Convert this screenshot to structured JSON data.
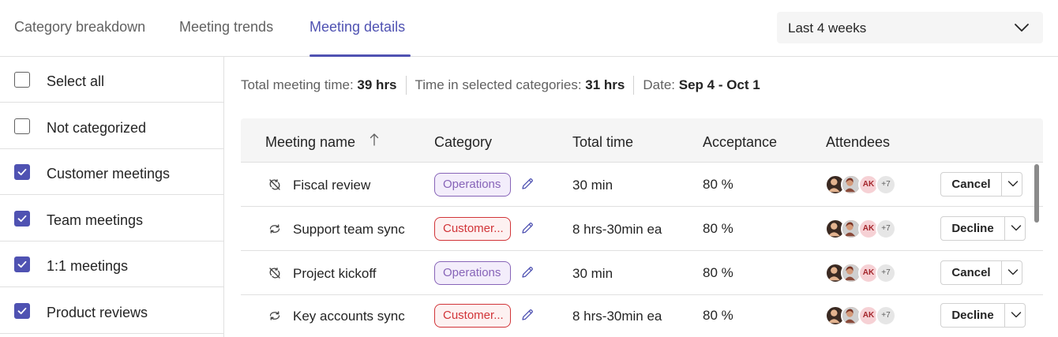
{
  "tabs": [
    {
      "label": "Category breakdown",
      "active": false
    },
    {
      "label": "Meeting trends",
      "active": false
    },
    {
      "label": "Meeting details",
      "active": true
    }
  ],
  "range_dropdown": {
    "value": "Last 4 weeks",
    "icon": "chevron-down-icon"
  },
  "filters": [
    {
      "label": "Select all",
      "checked": false
    },
    {
      "label": "Not categorized",
      "checked": false
    },
    {
      "label": "Customer meetings",
      "checked": true
    },
    {
      "label": "Team meetings",
      "checked": true
    },
    {
      "label": "1:1 meetings",
      "checked": true
    },
    {
      "label": "Product reviews",
      "checked": true
    }
  ],
  "summary": {
    "total_label": "Total meeting time:",
    "total_value": "39 hrs",
    "selected_label": "Time in selected categories:",
    "selected_value": "31 hrs",
    "date_label": "Date:",
    "date_value": "Sep 4 - Oct 1"
  },
  "table": {
    "columns": [
      "Meeting name",
      "Category",
      "Total time",
      "Acceptance",
      "Attendees"
    ],
    "sort": {
      "column": "Meeting name",
      "direction": "ascending"
    },
    "rows": [
      {
        "icon": "recurrence-off-icon",
        "name": "Fiscal review",
        "category": "Operations",
        "category_kind": "ops",
        "total_time": "30 min",
        "acceptance": "80 %",
        "avatar_initials": "AK",
        "more_attendees": "+7",
        "action": "Cancel"
      },
      {
        "icon": "recurrence-icon",
        "name": "Support team sync",
        "category": "Customer...",
        "category_kind": "cust",
        "total_time": "8 hrs-30min ea",
        "acceptance": "80 %",
        "avatar_initials": "AK",
        "more_attendees": "+7",
        "action": "Decline"
      },
      {
        "icon": "recurrence-off-icon",
        "name": "Project kickoff",
        "category": "Operations",
        "category_kind": "ops",
        "total_time": "30 min",
        "acceptance": "80 %",
        "avatar_initials": "AK",
        "more_attendees": "+7",
        "action": "Cancel"
      },
      {
        "icon": "recurrence-icon",
        "name": "Key accounts sync",
        "category": "Customer...",
        "category_kind": "cust",
        "total_time": "8 hrs-30min ea",
        "acceptance": "80 %",
        "avatar_initials": "AK",
        "more_attendees": "+7",
        "action": "Decline"
      }
    ]
  },
  "colors": {
    "accent": "#4f52b2",
    "operations": "#8764b8",
    "customer": "#d13438"
  }
}
